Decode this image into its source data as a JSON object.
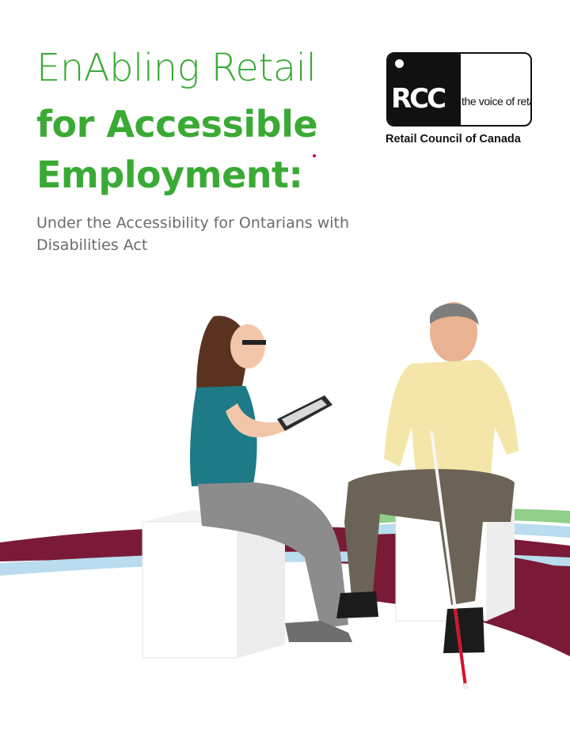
{
  "cover": {
    "title_line1": "EnAbling Retail",
    "title_line2": "for Accessible",
    "title_line3": "Employment:",
    "subtitle": "Under the Accessibility for Ontarians with Disabilities Act"
  },
  "logo": {
    "mark": "RCC",
    "tagline": "the voice of retail",
    "organization": "Retail Council of Canada"
  },
  "colors": {
    "brand_green": "#3aaa35",
    "maroon_swoosh": "#7a1a36",
    "light_blue_swoosh": "#b9dcee",
    "light_green_swoosh": "#8fcf8a"
  },
  "photo": {
    "description_icon": "people-photo"
  }
}
